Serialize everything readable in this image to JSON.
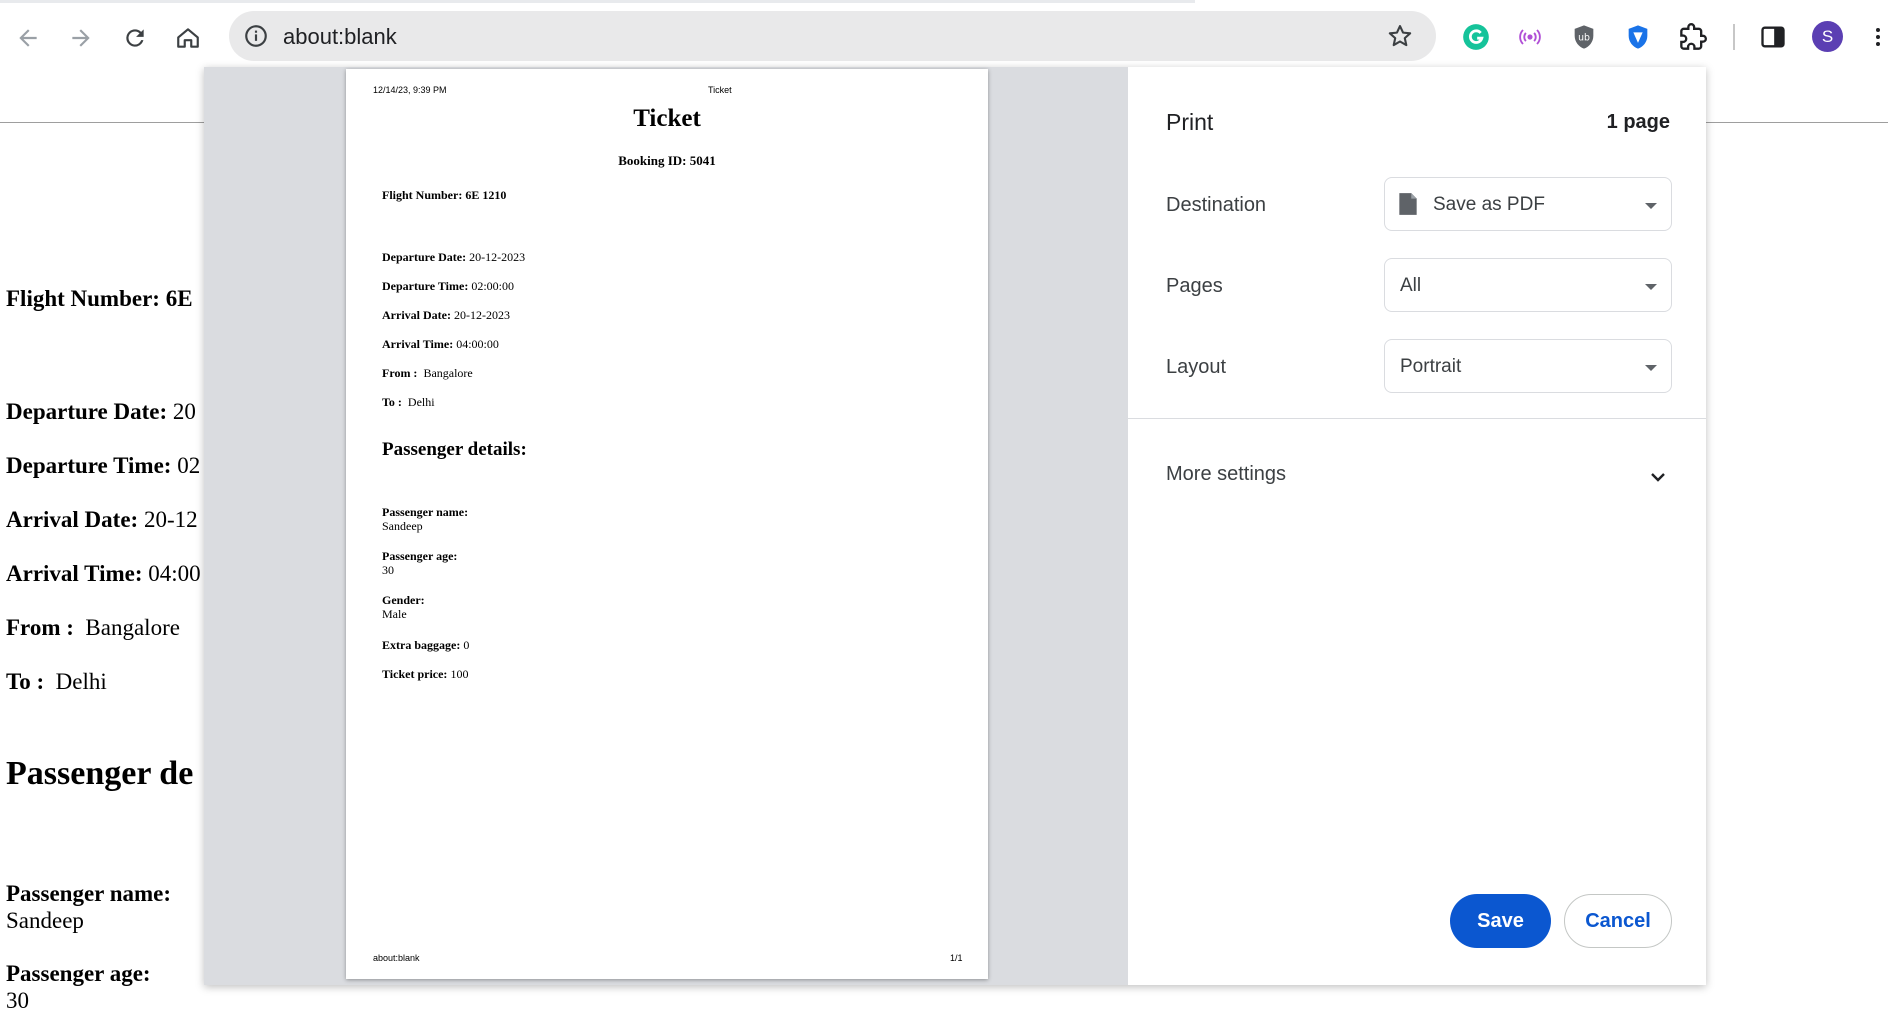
{
  "browser": {
    "url": "about:blank",
    "avatar_initial": "S",
    "accent": "#0b57d0"
  },
  "icons": [
    "back-icon",
    "forward-icon",
    "reload-icon",
    "home-icon",
    "info-icon",
    "star-icon",
    "grammarly-icon",
    "podcast-icon",
    "ublock-icon",
    "vpn-shield-icon",
    "extensions-icon",
    "side-panel-icon",
    "menu-icon",
    "document-icon",
    "chevron-down-icon"
  ],
  "underlying_page": {
    "flight_number_label": "Flight Number:",
    "flight_number_partial": "6E",
    "departure_date_label": "Departure Date:",
    "departure_date_partial": "20",
    "departure_time_label": "Departure Time:",
    "departure_time_partial": "02",
    "arrival_date_label": "Arrival Date:",
    "arrival_date_partial": "20-12",
    "arrival_time_label": "Arrival Time:",
    "arrival_time_partial": "04:00",
    "from_label": "From :",
    "from_value": "Bangalore",
    "to_label": "To :",
    "to_value": "Delhi",
    "passenger_heading_partial": "Passenger de",
    "passenger_name_label": "Passenger name:",
    "passenger_name_value": "Sandeep",
    "passenger_age_label": "Passenger age:",
    "passenger_age_value": "30"
  },
  "print_preview": {
    "header_left": "12/14/23, 9:39 PM",
    "header_center": "Ticket",
    "title": "Ticket",
    "booking_id": "Booking ID: 5041",
    "flight_number": "Flight Number: 6E 1210",
    "departure_date_label": "Departure Date:",
    "departure_date": "20-12-2023",
    "departure_time_label": "Departure Time:",
    "departure_time": "02:00:00",
    "arrival_date_label": "Arrival Date:",
    "arrival_date": "20-12-2023",
    "arrival_time_label": "Arrival Time:",
    "arrival_time": "04:00:00",
    "from_label": "From :",
    "from_value": "Bangalore",
    "to_label": "To :",
    "to_value": "Delhi",
    "passenger_details_heading": "Passenger details:",
    "passenger_name_label": "Passenger name:",
    "passenger_name": "Sandeep",
    "passenger_age_label": "Passenger age:",
    "passenger_age": "30",
    "gender_label": "Gender:",
    "gender": "Male",
    "extra_baggage_label": "Extra baggage:",
    "extra_baggage": "0",
    "ticket_price_label": "Ticket price:",
    "ticket_price": "100",
    "footer_left": "about:blank",
    "footer_right": "1/1"
  },
  "print_settings": {
    "title": "Print",
    "page_count": "1 page",
    "destination_label": "Destination",
    "destination_value": "Save as PDF",
    "pages_label": "Pages",
    "pages_value": "All",
    "layout_label": "Layout",
    "layout_value": "Portrait",
    "more_settings": "More settings",
    "save_label": "Save",
    "cancel_label": "Cancel"
  }
}
